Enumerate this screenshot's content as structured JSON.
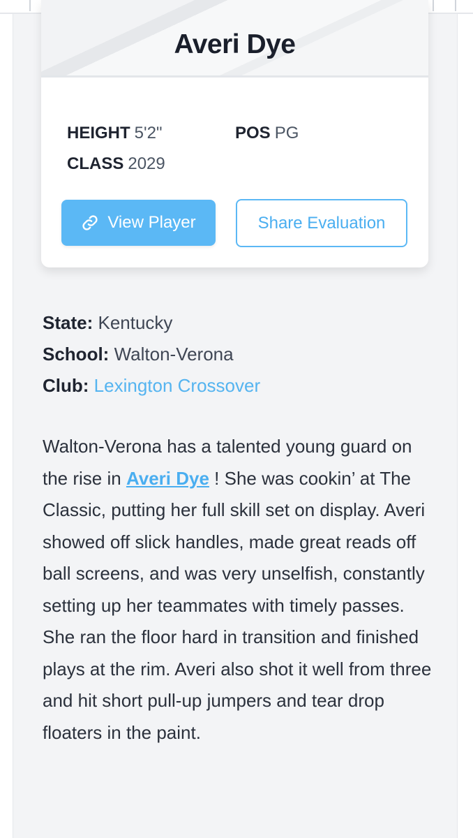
{
  "player": {
    "name": "Averi Dye",
    "height_label": "HEIGHT",
    "height_value": "5'2\"",
    "pos_label": "POS",
    "pos_value": "PG",
    "class_label": "CLASS",
    "class_value": "2029"
  },
  "actions": {
    "view_player_label": "View Player",
    "share_evaluation_label": "Share Evaluation",
    "view_player_icon": "link-icon"
  },
  "info": {
    "state_label": "State:",
    "state_value": "Kentucky",
    "school_label": "School:",
    "school_value": "Walton-Verona",
    "club_label": "Club:",
    "club_value": "Lexington Crossover"
  },
  "evaluation": {
    "text_before": "Walton-Verona has a talented young guard on the rise in ",
    "player_link": "Averi Dye",
    "text_after": " ! She was cookin’ at The Classic, putting her full skill set on display. Averi showed off slick handles, made great reads off ball screens, and was very unselfish, constantly setting up her teammates with timely passes. She ran the floor hard in transition and finished plays at the rim. Averi also shot it well from three and hit short pull-up jumpers and tear drop floaters in the paint."
  },
  "colors": {
    "accent": "#5bb8f5",
    "link": "#4aaef0",
    "panel_bg": "#f3f4f6",
    "text": "#1f2430"
  }
}
